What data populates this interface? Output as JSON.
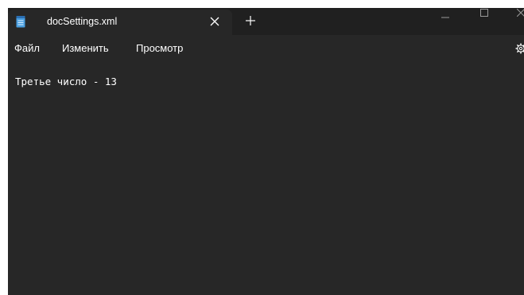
{
  "tab": {
    "title": "docSettings.xml",
    "icon": "notepad-icon"
  },
  "menu": {
    "items": [
      "Файл",
      "Изменить",
      "Просмотр"
    ]
  },
  "editor": {
    "lines": [
      "Третье число - 13"
    ]
  },
  "colors": {
    "titlebar": "#202020",
    "background": "#272727",
    "text": "#ffffff",
    "icon_blue": "#4a9fe0"
  }
}
